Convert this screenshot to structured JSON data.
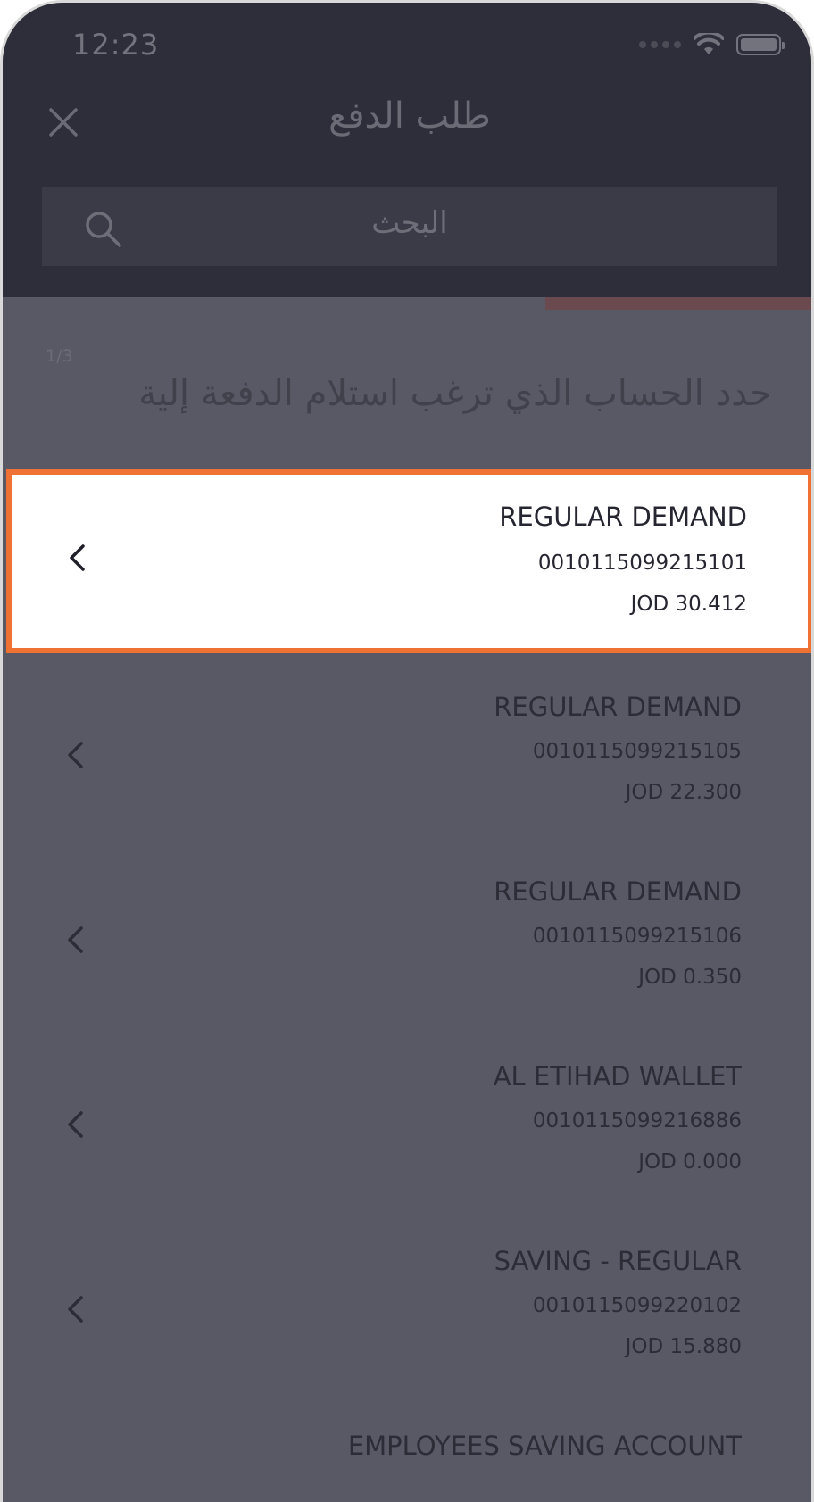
{
  "status_bar": {
    "time": "12:23"
  },
  "header": {
    "title": "طلب الدفع",
    "close_icon": "close-icon"
  },
  "search": {
    "placeholder": "البحث",
    "icon": "search-icon"
  },
  "step": {
    "indicator": "1/3",
    "instruction": "حدد الحساب الذي ترغب استلام الدفعة إلية"
  },
  "accounts": [
    {
      "name": "REGULAR DEMAND",
      "number": "0010115099215101",
      "balance": "JOD 30.412",
      "selected": true
    },
    {
      "name": "REGULAR DEMAND",
      "number": "0010115099215105",
      "balance": "JOD 22.300",
      "selected": false
    },
    {
      "name": "REGULAR DEMAND",
      "number": "0010115099215106",
      "balance": "JOD 0.350",
      "selected": false
    },
    {
      "name": "AL ETIHAD WALLET",
      "number": "0010115099216886",
      "balance": "JOD 0.000",
      "selected": false
    },
    {
      "name": "SAVING - REGULAR",
      "number": "0010115099220102",
      "balance": "JOD 15.880",
      "selected": false
    },
    {
      "name": "EMPLOYEES SAVING ACCOUNT",
      "number": "",
      "balance": "",
      "selected": false
    }
  ],
  "colors": {
    "header_bg": "#2e2e3a",
    "overlay_bg": "#595966",
    "highlight_border": "#ef7134",
    "progress_accent": "#6b4a4f"
  }
}
